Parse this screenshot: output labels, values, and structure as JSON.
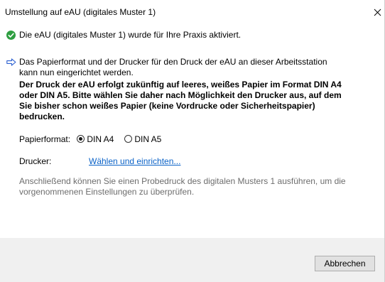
{
  "window": {
    "title": "Umstellung auf eAU (digitales Muster 1)"
  },
  "info": {
    "activated": "Die eAU (digitales Muster 1) wurde für Ihre Praxis aktiviert.",
    "setup_line1": "Das Papierformat und der Drucker für den Druck der eAU an dieser Arbeitsstation",
    "setup_line2": "kann nun eingerichtet werden.",
    "warning_lines": [
      "Der Druck der eAU erfolgt zukünftig auf leeres, weißes Papier im Format DIN A4",
      "oder DIN A5. Bitte wählen Sie daher nach Möglichkeit den Drucker aus, auf dem",
      "Sie bisher schon weißes Papier (keine Vordrucke oder Sicherheitspapier)",
      "bedrucken."
    ]
  },
  "paper_format": {
    "label": "Papierformat:",
    "options": [
      "DIN A4",
      "DIN A5"
    ],
    "selected": "DIN A4"
  },
  "printer": {
    "label": "Drucker:",
    "link": "Wählen und einrichten..."
  },
  "hint": {
    "line1": "Anschließend können Sie einen Probedruck des digitalen Musters 1 ausführen, um die",
    "line2": "vorgenommenen Einstellungen zu überprüfen."
  },
  "footer": {
    "cancel_label": "Abbrechen"
  },
  "colors": {
    "success": "#2e9e41",
    "accent": "#0a62c7",
    "footer_bg": "#f0f0f0"
  },
  "icons": {
    "success": "check-circle-icon",
    "info": "arrow-right-icon",
    "close": "close-icon"
  }
}
